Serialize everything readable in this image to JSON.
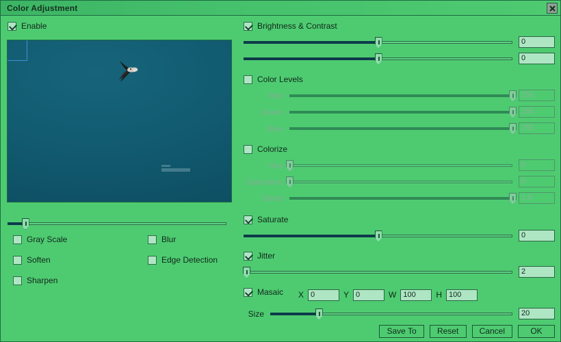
{
  "window": {
    "title": "Color Adjustment",
    "close_icon": "close-icon"
  },
  "left_panel": {
    "enable": {
      "label": "Enable",
      "checked": true
    },
    "preview": {
      "selection_rect": true,
      "zoom_slider": {
        "value_percent": 8
      }
    },
    "filters": [
      {
        "label": "Gray Scale",
        "checked": false
      },
      {
        "label": "Soften",
        "checked": false
      },
      {
        "label": "Sharpen",
        "checked": false
      },
      {
        "label": "Blur",
        "checked": false
      },
      {
        "label": "Edge Detection",
        "checked": false
      }
    ]
  },
  "right_panel": {
    "brightness_contrast": {
      "label": "Brightness & Contrast",
      "checked": true,
      "enabled": true,
      "sliders": [
        {
          "name": "brightness",
          "value": "0",
          "percent": 50
        },
        {
          "name": "contrast",
          "value": "0",
          "percent": 50
        }
      ]
    },
    "color_levels": {
      "label": "Color Levels",
      "checked": false,
      "enabled": false,
      "sliders": [
        {
          "label": "Red",
          "value": "255",
          "percent": 100
        },
        {
          "label": "Green",
          "value": "255",
          "percent": 100
        },
        {
          "label": "Blue",
          "value": "255",
          "percent": 100
        }
      ]
    },
    "colorize": {
      "label": "Colorize",
      "checked": false,
      "enabled": false,
      "sliders": [
        {
          "label": "Hue",
          "value": "0",
          "percent": 0
        },
        {
          "label": "Saturation",
          "value": "0",
          "percent": 0
        },
        {
          "label": "Blend",
          "value": "1.0",
          "percent": 100
        }
      ]
    },
    "saturate": {
      "label": "Saturate",
      "checked": true,
      "enabled": true,
      "slider": {
        "value": "0",
        "percent": 50
      }
    },
    "jitter": {
      "label": "Jitter",
      "checked": true,
      "enabled": true,
      "slider": {
        "value": "2",
        "percent": 1
      }
    },
    "masaic": {
      "label": "Masaic",
      "checked": true,
      "enabled": true,
      "fields": [
        {
          "label": "X",
          "value": "0"
        },
        {
          "label": "Y",
          "value": "0"
        },
        {
          "label": "W",
          "value": "100"
        },
        {
          "label": "H",
          "value": "100"
        }
      ],
      "size": {
        "label": "Size",
        "value": "20",
        "percent": 20
      }
    }
  },
  "buttons": {
    "save_to": "Save To",
    "reset": "Reset",
    "cancel": "Cancel",
    "ok": "OK"
  }
}
